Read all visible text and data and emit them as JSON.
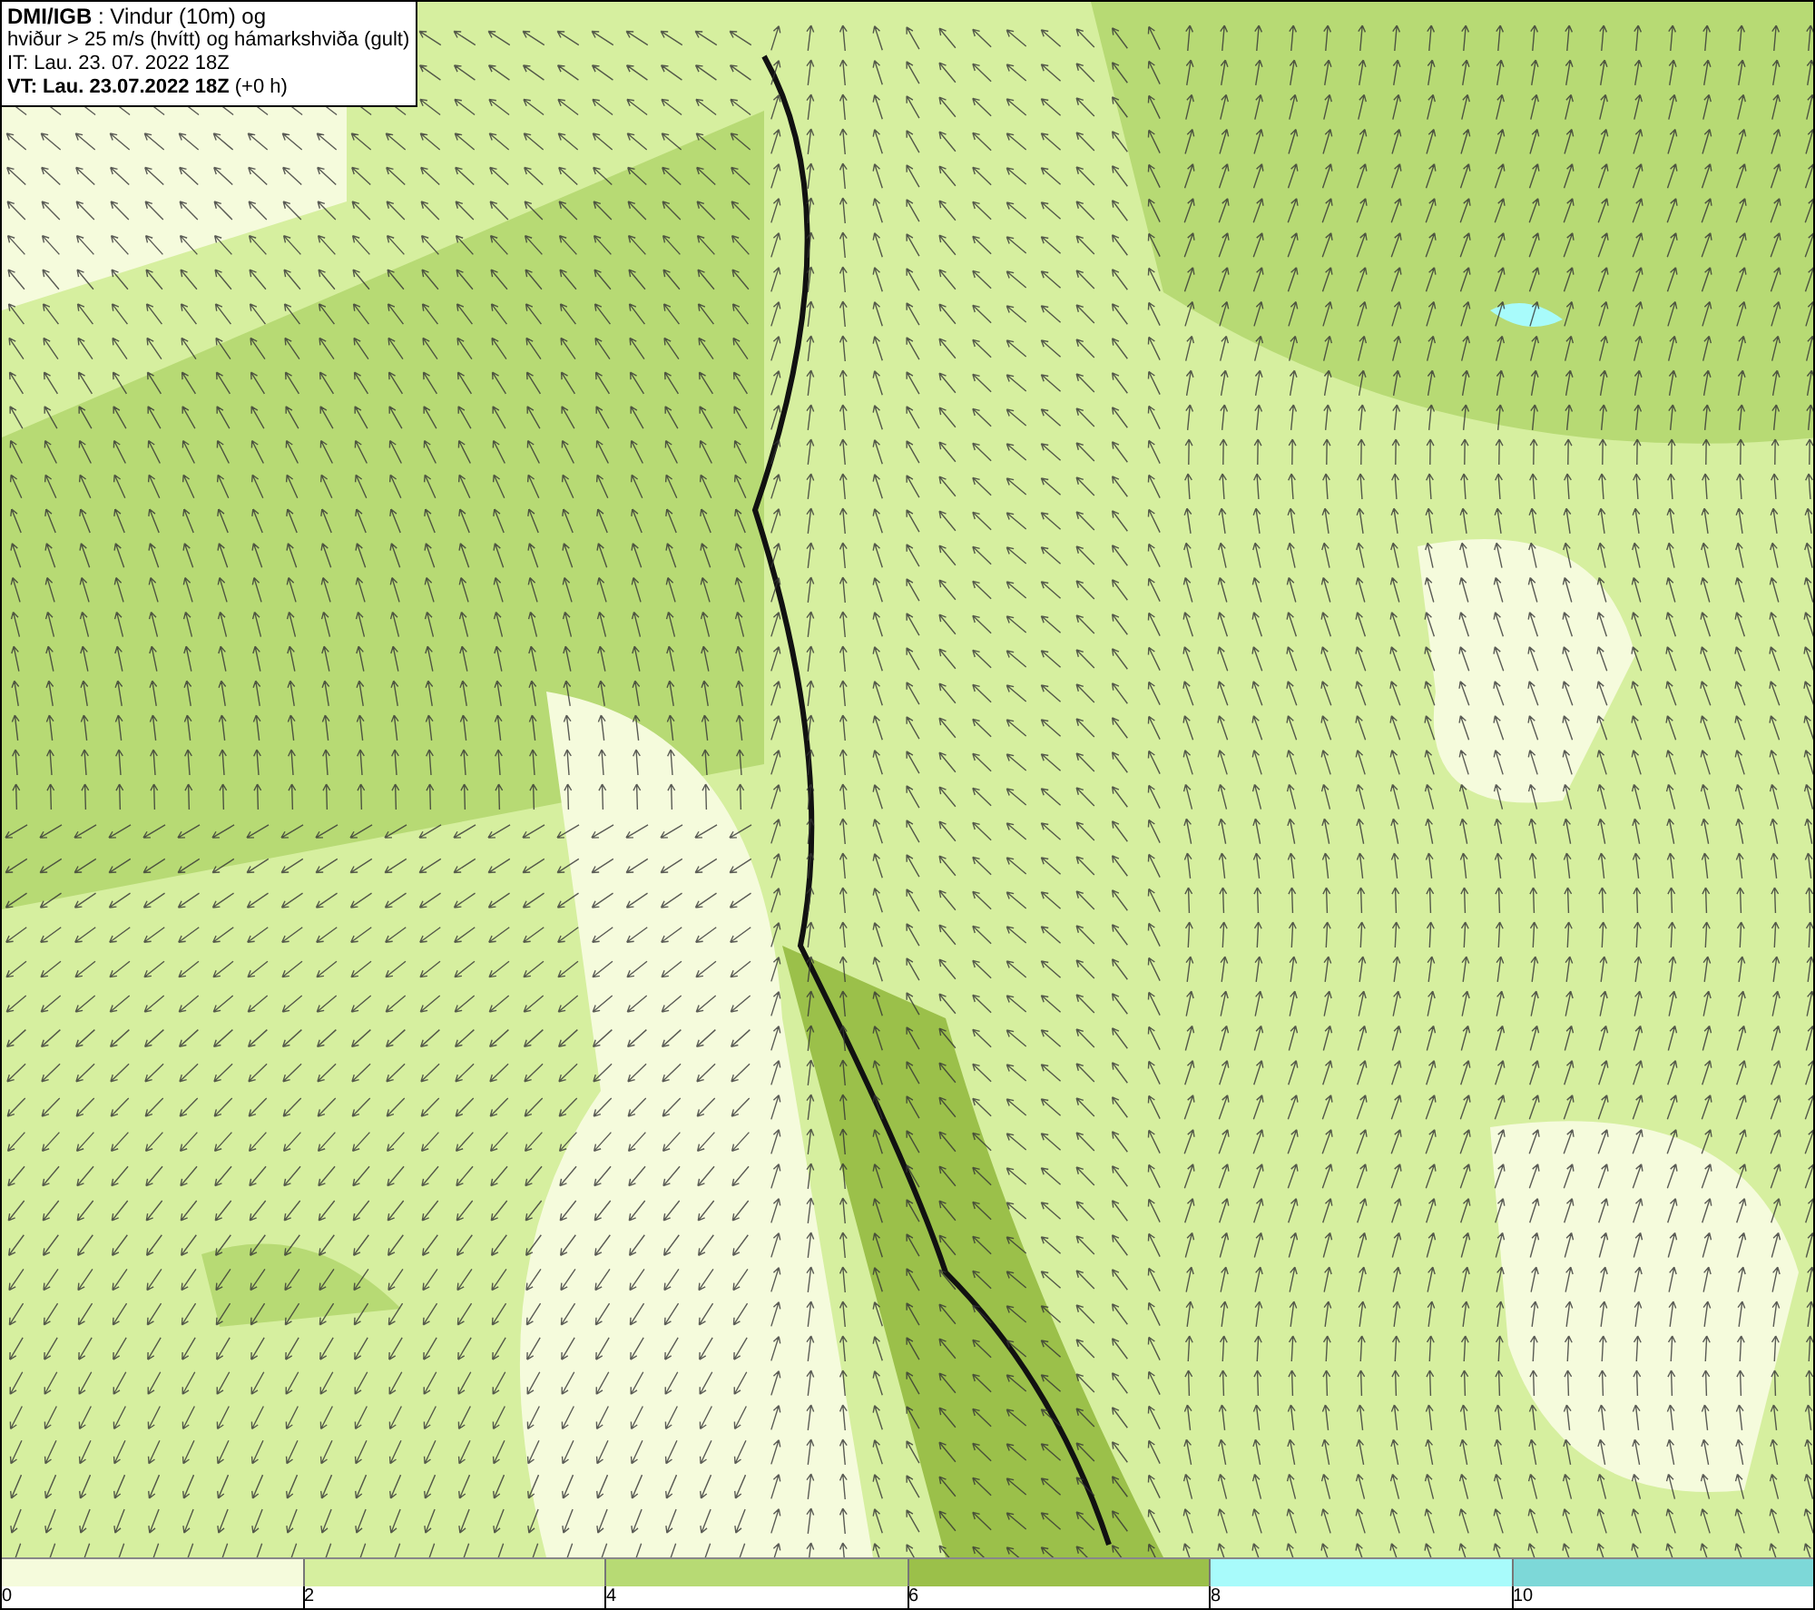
{
  "header": {
    "lines": [
      "**DMI/IGB** : Vindur (10m) og",
      "hviður > 25 m/s (hvítt) og hámarkshviða (gult)",
      "IT: Lau. 23. 07. 2022 18Z",
      "**VT: Lau. 23.07.2022 18Z** (+0 h)"
    ]
  },
  "legend": {
    "bins": [
      {
        "label": "0",
        "color": "#f5fbdc"
      },
      {
        "label": "2",
        "color": "#d6ef9f"
      },
      {
        "label": "4",
        "color": "#b7da74"
      },
      {
        "label": "6",
        "color": "#9bc04a"
      },
      {
        "label": "8",
        "color": "#a8fbfb"
      },
      {
        "label": "10",
        "color": "#7dd8d8"
      }
    ]
  }
}
